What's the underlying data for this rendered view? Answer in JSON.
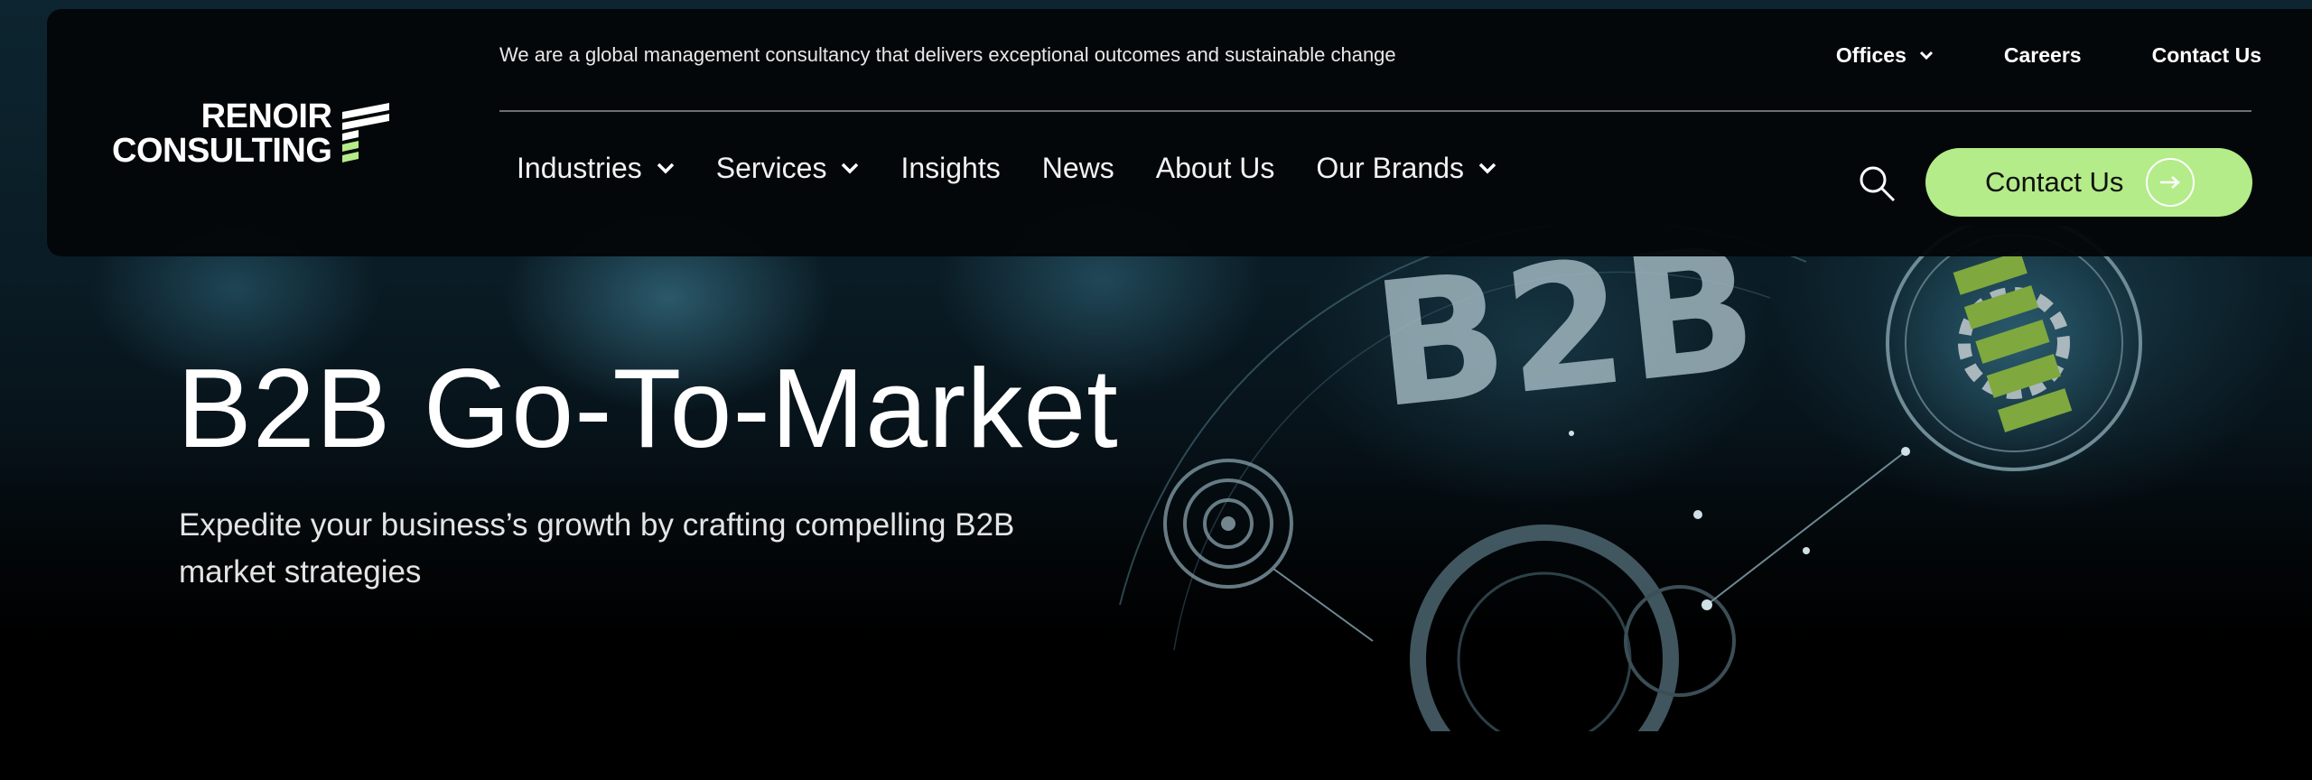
{
  "brand": {
    "line1": "RENOIR",
    "line2": "CONSULTING",
    "accent_color": "#b3ec88"
  },
  "header": {
    "tagline": "We are a global management consultancy that delivers exceptional outcomes and sustainable change",
    "utility_nav": {
      "offices": "Offices",
      "careers": "Careers",
      "contact": "Contact Us"
    },
    "main_nav": {
      "industries": "Industries",
      "services": "Services",
      "insights": "Insights",
      "news": "News",
      "about": "About Us",
      "brands": "Our Brands"
    },
    "search_icon": "search-icon",
    "cta_label": "Contact Us",
    "cta_icon": "arrow-right-icon"
  },
  "hero": {
    "title": "B2B Go-To-Market",
    "subtitle": "Expedite your business’s growth by crafting compelling B2B market strategies",
    "image_text": "B2B"
  }
}
